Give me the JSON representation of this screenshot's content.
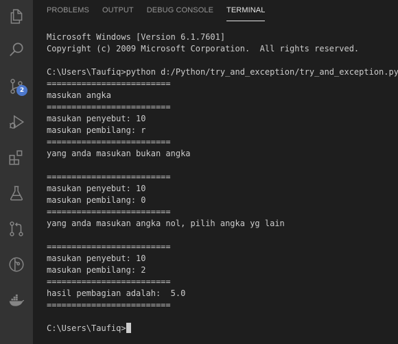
{
  "activity_bar": {
    "items": [
      {
        "name": "explorer-icon"
      },
      {
        "name": "search-icon"
      },
      {
        "name": "source-control-icon",
        "badge": "2"
      },
      {
        "name": "run-debug-icon"
      },
      {
        "name": "extensions-icon"
      },
      {
        "name": "testing-icon"
      },
      {
        "name": "pull-request-icon"
      },
      {
        "name": "git-graph-icon"
      },
      {
        "name": "docker-icon"
      }
    ]
  },
  "panel": {
    "tabs": [
      {
        "label": "PROBLEMS",
        "active": false
      },
      {
        "label": "OUTPUT",
        "active": false
      },
      {
        "label": "DEBUG CONSOLE",
        "active": false
      },
      {
        "label": "TERMINAL",
        "active": true
      }
    ]
  },
  "terminal": {
    "lines": [
      "Microsoft Windows [Version 6.1.7601]",
      "Copyright (c) 2009 Microsoft Corporation.  All rights reserved.",
      "",
      "C:\\Users\\Taufiq>python d:/Python/try_and_exception/try_and_exception.py",
      "=========================",
      "masukan angka",
      "=========================",
      "masukan penyebut: 10",
      "masukan pembilang: r",
      "=========================",
      "yang anda masukan bukan angka",
      "",
      "=========================",
      "masukan penyebut: 10",
      "masukan pembilang: 0",
      "=========================",
      "yang anda masukan angka nol, pilih angka yg lain",
      "",
      "=========================",
      "masukan penyebut: 10",
      "masukan pembilang: 2",
      "=========================",
      "hasil pembagian adalah:  5.0",
      "=========================",
      "",
      "C:\\Users\\Taufiq>"
    ]
  },
  "colors": {
    "activity_bar_bg": "#333333",
    "panel_bg": "#1e1e1e",
    "text": "#cccccc",
    "tab_inactive": "#969696",
    "tab_active": "#e7e7e7",
    "badge": "#4d78cc"
  }
}
